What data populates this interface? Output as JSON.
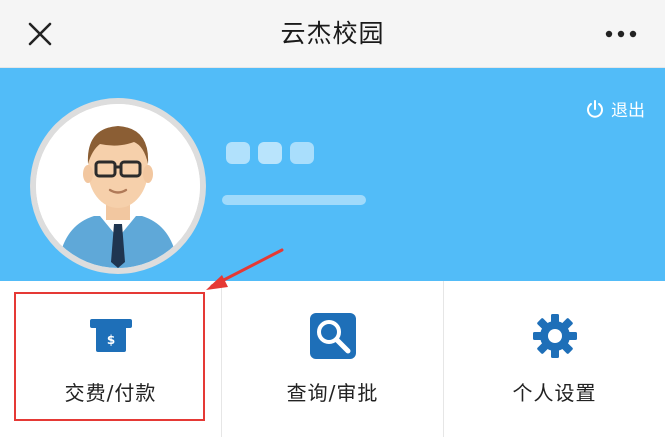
{
  "header": {
    "title": "云杰校园",
    "close_icon": "close-icon",
    "more_icon": "more-icon"
  },
  "profile": {
    "background_color": "#52bcf8",
    "avatar": "avatar-man-glasses",
    "logout_label": "退出",
    "logout_icon": "power-icon"
  },
  "menu": {
    "items": [
      {
        "label": "交费/付款",
        "icon": "payment-card-icon"
      },
      {
        "label": "查询/审批",
        "icon": "search-icon"
      },
      {
        "label": "个人设置",
        "icon": "gear-icon"
      }
    ],
    "icon_color": "#1e6fb8"
  },
  "annotation": {
    "color": "#e53935"
  }
}
